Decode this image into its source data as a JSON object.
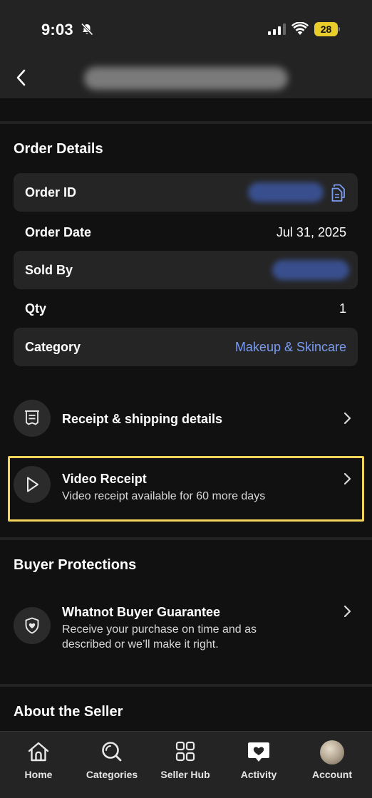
{
  "status_bar": {
    "time": "9:03",
    "battery": "28",
    "icons": [
      "bell-slash-icon",
      "cellular-signal-icon",
      "wifi-icon",
      "battery-icon"
    ]
  },
  "header": {
    "back_icon": "chevron-left-icon",
    "title_state": "blurred"
  },
  "order_details": {
    "title": "Order Details",
    "rows": [
      {
        "label": "Order ID",
        "value_state": "blurred",
        "icon": "copy-icon"
      },
      {
        "label": "Order Date",
        "value": "Jul 31, 2025"
      },
      {
        "label": "Sold By",
        "value_state": "blurred"
      },
      {
        "label": "Qty",
        "value": "1"
      },
      {
        "label": "Category",
        "value": "Makeup & Skincare",
        "value_color": "#7b9cf0"
      }
    ]
  },
  "actions": {
    "receipt": {
      "title": "Receipt & shipping details",
      "icon": "receipt-icon"
    },
    "video_receipt": {
      "title": "Video Receipt",
      "subtitle": "Video receipt available for 60 more days",
      "icon": "play-icon",
      "highlight_color": "#f2d45b"
    }
  },
  "buyer_protections": {
    "title": "Buyer Protections",
    "guarantee": {
      "title": "Whatnot Buyer Guarantee",
      "subtitle": "Receive your purchase on time and as described or we’ll make it right.",
      "icon": "shield-icon"
    }
  },
  "about_seller": {
    "title": "About the Seller"
  },
  "tab_bar": {
    "active": "Activity",
    "tabs": [
      {
        "label": "Home",
        "icon": "home-icon"
      },
      {
        "label": "Categories",
        "icon": "search-icon"
      },
      {
        "label": "Seller Hub",
        "icon": "grid-icon"
      },
      {
        "label": "Activity",
        "icon": "heart-bubble-icon"
      },
      {
        "label": "Account",
        "icon": "avatar-icon"
      }
    ]
  },
  "colors": {
    "background": "#111111",
    "card": "#252525",
    "accent_link": "#7b9cf0",
    "highlight": "#f2d45b"
  }
}
